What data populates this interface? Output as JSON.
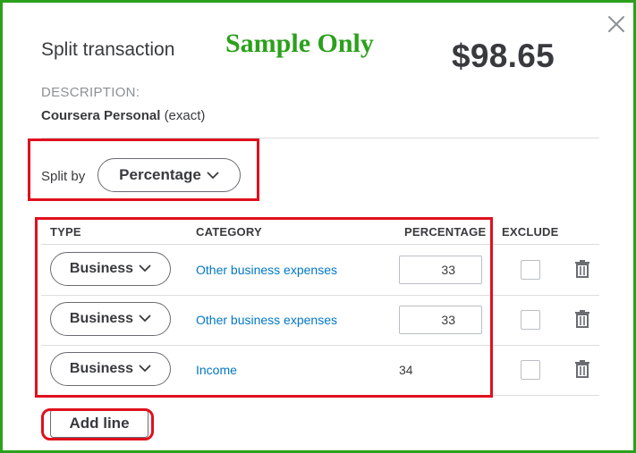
{
  "dialog": {
    "title": "Split transaction",
    "watermark": "Sample Only",
    "amount": "$98.65",
    "description_label": "DESCRIPTION:",
    "description_name": "Coursera Personal",
    "description_match": "(exact)"
  },
  "split": {
    "label": "Split by",
    "value": "Percentage"
  },
  "table": {
    "headers": {
      "type": "TYPE",
      "category": "CATEGORY",
      "percentage": "PERCENTAGE",
      "exclude": "EXCLUDE"
    },
    "rows": [
      {
        "type": "Business",
        "category": "Other business expenses",
        "percentage": "33",
        "percentage_editable": true,
        "exclude": false
      },
      {
        "type": "Business",
        "category": "Other business expenses",
        "percentage": "33",
        "percentage_editable": true,
        "exclude": false
      },
      {
        "type": "Business",
        "category": "Income",
        "percentage": "34",
        "percentage_editable": false,
        "exclude": false
      }
    ]
  },
  "actions": {
    "add_line": "Add line"
  },
  "icons": {
    "close": "close-icon",
    "chevron": "chevron-down-icon",
    "trash": "trash-icon"
  },
  "colors": {
    "brand_green": "#2ca01c",
    "link_blue": "#0077c5",
    "annotation_red": "#e0101e",
    "text": "#393a3d",
    "muted": "#8d9096"
  }
}
